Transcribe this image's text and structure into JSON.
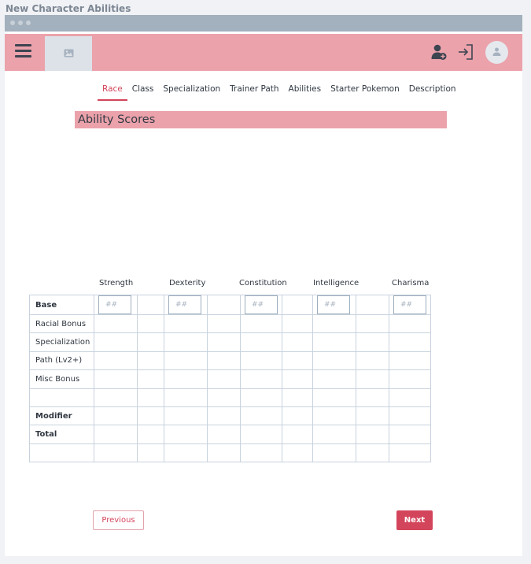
{
  "window": {
    "title": "New Character Abilities"
  },
  "appbar": {
    "menu_icon": "hamburger-icon",
    "image_icon": "image-icon",
    "add_user_icon": "add-user-icon",
    "login_icon": "login-icon",
    "avatar_icon": "user-icon",
    "colors": {
      "appbar": "#eba2ab",
      "accent": "#d3455b",
      "chrome": "#a3b0bd"
    }
  },
  "tabs": [
    {
      "label": "Race",
      "active": true
    },
    {
      "label": "Class",
      "active": false
    },
    {
      "label": "Specialization",
      "active": false
    },
    {
      "label": "Trainer Path",
      "active": false
    },
    {
      "label": "Abilities",
      "active": false
    },
    {
      "label": "Starter Pokemon",
      "active": false
    },
    {
      "label": "Description",
      "active": false
    }
  ],
  "section": {
    "title": "Ability Scores"
  },
  "abilities": {
    "headers": [
      "Strength",
      "Dexterity",
      "Constitution",
      "Intelligence",
      "Charisma"
    ],
    "input_placeholder": "##",
    "rows": [
      {
        "label": "Base",
        "bold": true
      },
      {
        "label": "Racial Bonus",
        "bold": false
      },
      {
        "label": "Specialization",
        "bold": false
      },
      {
        "label": "Path (Lv2+)",
        "bold": false
      },
      {
        "label": "Misc Bonus",
        "bold": false
      },
      {
        "label": "",
        "bold": false
      },
      {
        "label": "Modifier",
        "bold": true
      },
      {
        "label": "Total",
        "bold": true
      },
      {
        "label": "",
        "bold": false
      }
    ]
  },
  "nav": {
    "previous_label": "Previous",
    "next_label": "Next"
  }
}
